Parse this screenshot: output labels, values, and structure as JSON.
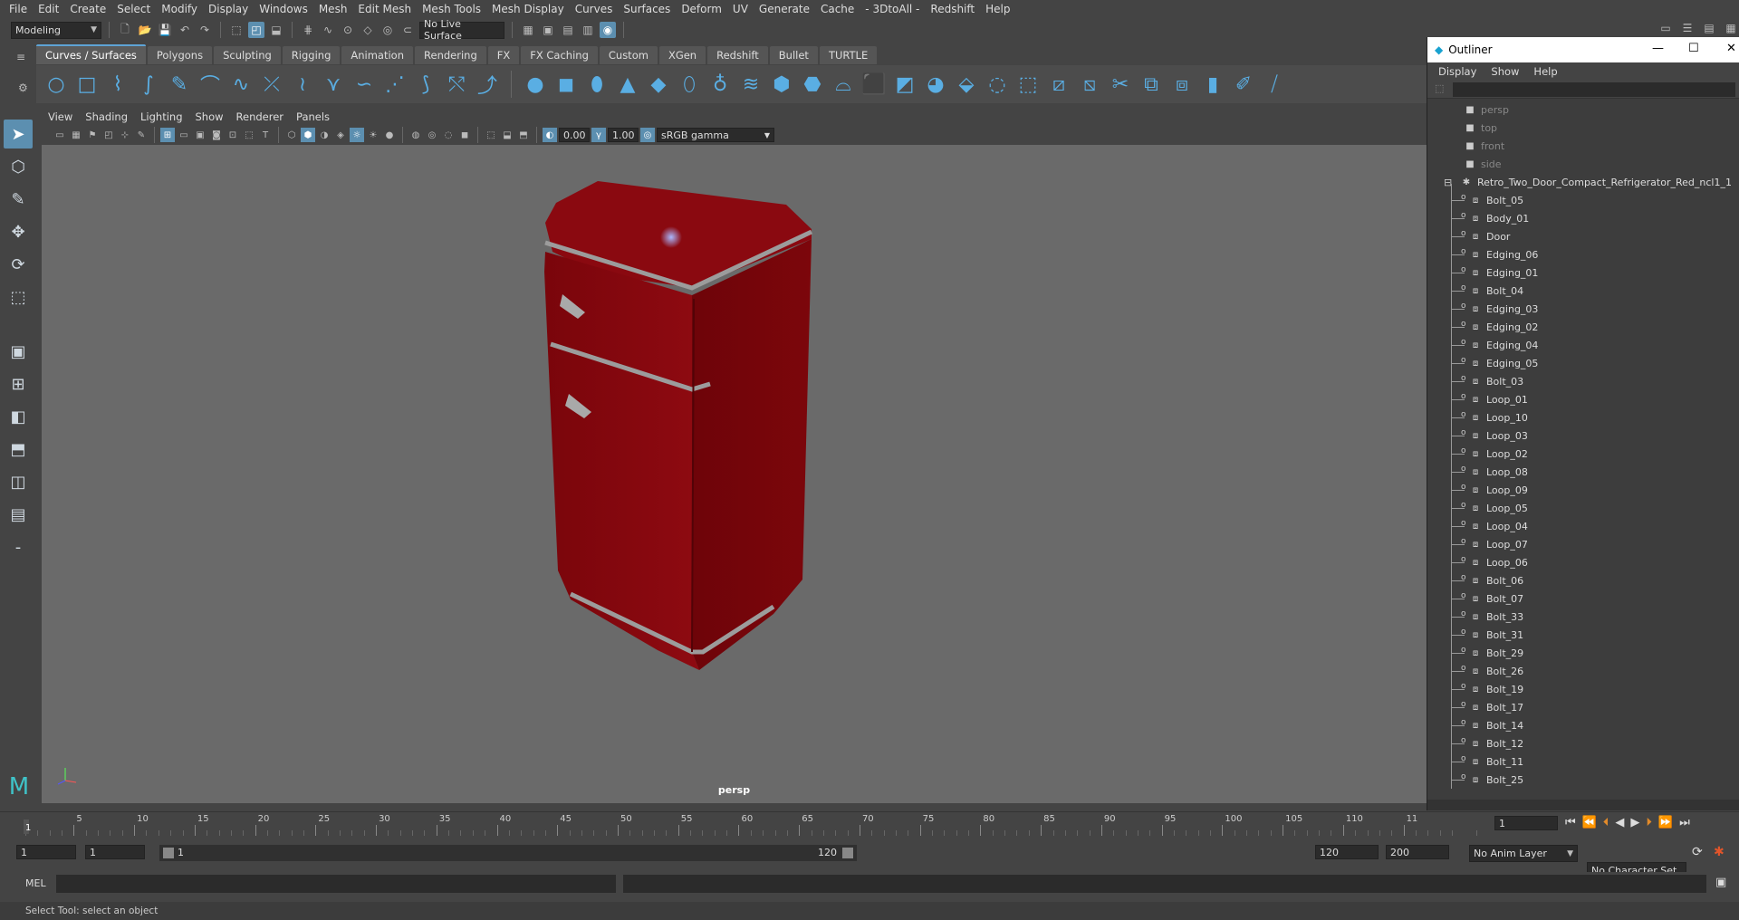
{
  "menubar": [
    "File",
    "Edit",
    "Create",
    "Select",
    "Modify",
    "Display",
    "Windows",
    "Mesh",
    "Edit Mesh",
    "Mesh Tools",
    "Mesh Display",
    "Curves",
    "Surfaces",
    "Deform",
    "UV",
    "Generate",
    "Cache",
    "- 3DtoAll -",
    "Redshift",
    "Help"
  ],
  "status": {
    "mode": "Modeling",
    "live_surface": "No Live Surface"
  },
  "shelf_tabs": [
    {
      "label": "Curves / Surfaces",
      "active": true
    },
    {
      "label": "Polygons"
    },
    {
      "label": "Sculpting"
    },
    {
      "label": "Rigging"
    },
    {
      "label": "Animation"
    },
    {
      "label": "Rendering"
    },
    {
      "label": "FX"
    },
    {
      "label": "FX Caching"
    },
    {
      "label": "Custom"
    },
    {
      "label": "XGen"
    },
    {
      "label": "Redshift"
    },
    {
      "label": "Bullet"
    },
    {
      "label": "TURTLE"
    }
  ],
  "viewport": {
    "menu": [
      "View",
      "Shading",
      "Lighting",
      "Show",
      "Renderer",
      "Panels"
    ],
    "exposure": "0.00",
    "gamma": "1.00",
    "color_space": "sRGB gamma",
    "camera_label": "persp",
    "model_color": "#8b0a10"
  },
  "outliner": {
    "title": "Outliner",
    "menu": [
      "Display",
      "Show",
      "Help"
    ],
    "cameras": [
      "persp",
      "top",
      "front",
      "side"
    ],
    "group": "Retro_Two_Door_Compact_Refrigerator_Red_ncl1_1",
    "children": [
      "Bolt_05",
      "Body_01",
      "Door",
      "Edging_06",
      "Edging_01",
      "Bolt_04",
      "Edging_03",
      "Edging_02",
      "Edging_04",
      "Edging_05",
      "Bolt_03",
      "Loop_01",
      "Loop_10",
      "Loop_03",
      "Loop_02",
      "Loop_08",
      "Loop_09",
      "Loop_05",
      "Loop_04",
      "Loop_07",
      "Loop_06",
      "Bolt_06",
      "Bolt_07",
      "Bolt_33",
      "Bolt_31",
      "Bolt_29",
      "Bolt_26",
      "Bolt_19",
      "Bolt_17",
      "Bolt_14",
      "Bolt_12",
      "Bolt_11",
      "Bolt_25"
    ]
  },
  "timeline": {
    "ticks": [
      "5",
      "10",
      "15",
      "20",
      "25",
      "30",
      "35",
      "40",
      "45",
      "50",
      "55",
      "60",
      "65",
      "70",
      "75",
      "80",
      "85",
      "90",
      "95",
      "100",
      "105",
      "110",
      "11"
    ],
    "start_label": "1",
    "current_frame": "1"
  },
  "range": {
    "start": "1",
    "anim_start": "1",
    "slider_start": "1",
    "slider_end": "120",
    "end": "120",
    "anim_end": "200",
    "anim_layer": "No Anim Layer",
    "character_set": "No Character Set"
  },
  "cmdline": {
    "label": "MEL"
  },
  "helpline": "Select Tool: select an object"
}
